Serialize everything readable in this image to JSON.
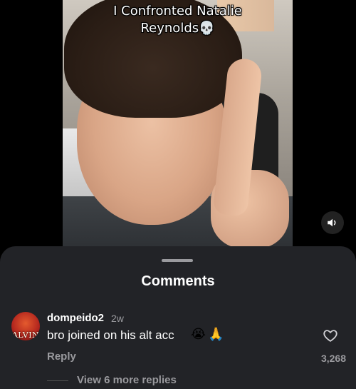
{
  "video": {
    "caption": "I Confronted Natalie\nReynolds💀",
    "volume_icon": "speaker-on-icon"
  },
  "comments": {
    "title": "Comments",
    "items": [
      {
        "username": "dompeido2",
        "time": "2w",
        "avatar_label": "ALVIN",
        "text": "bro joined on his alt acc",
        "emojis": [
          "😭",
          "🙏"
        ],
        "reply_label": "Reply",
        "like_count": "3,268",
        "like_icon": "heart-outline-icon",
        "more_replies": "View 6 more replies"
      }
    ]
  },
  "colors": {
    "sheet_bg": "#222327",
    "muted_text": "#9a9a9e",
    "primary_text": "#ffffff"
  }
}
